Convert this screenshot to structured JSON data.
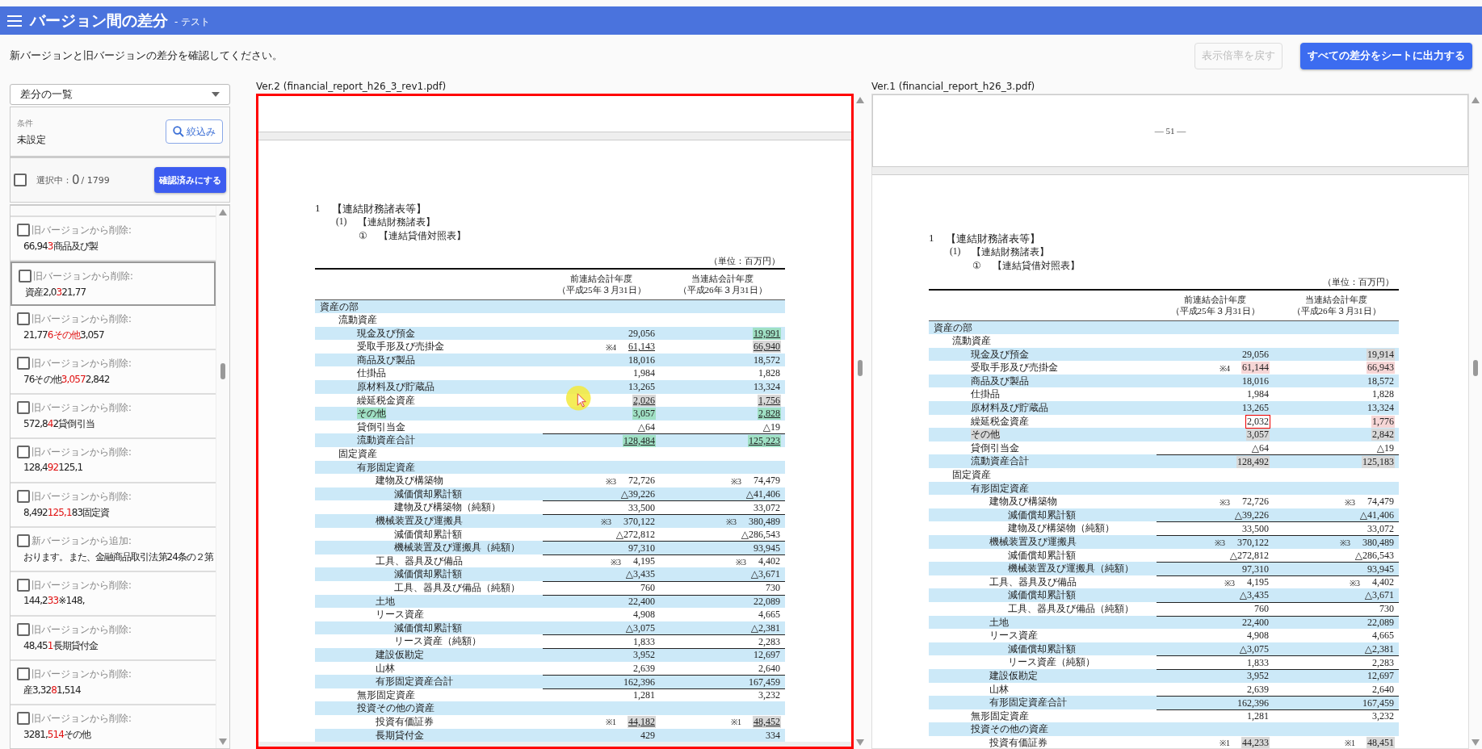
{
  "header": {
    "title": "バージョン間の差分",
    "subtitle": "- テスト"
  },
  "instruction": "新バージョンと旧バージョンの差分を確認してください。",
  "actions": [
    {
      "label": "表示倍率を戻す",
      "disabled": true
    },
    {
      "label": "すべての差分をシートに出力する",
      "disabled": false
    }
  ],
  "sidebar": {
    "dropdown": "差分の一覧",
    "condition_label": "条件",
    "condition_value": "未設定",
    "filter_button": "絞込み",
    "select_all_checked": false,
    "selected_label": "選択中：",
    "selected_count": "0",
    "total": "/ 1799",
    "confirm_button": "確認済みにする",
    "items": [
      {
        "label": "旧バージョンから削除:",
        "before": "66,94",
        "changed": "3",
        "after": "商品及び製",
        "checked": false,
        "selected": false
      },
      {
        "label": "旧バージョンから削除:",
        "before": "資産2,0",
        "changed": "3",
        "after": "21,77",
        "checked": false,
        "selected": true
      },
      {
        "label": "旧バージョンから削除:",
        "before": "21,77",
        "changed": "6その他",
        "after": "3,057",
        "checked": false,
        "selected": false
      },
      {
        "label": "旧バージョンから削除:",
        "before": "76その他",
        "changed": "3,057",
        "after": "2,842",
        "checked": false,
        "selected": false
      },
      {
        "label": "旧バージョンから削除:",
        "before": "572,8",
        "changed": "4",
        "after": "2貸倒引当",
        "checked": false,
        "selected": false
      },
      {
        "label": "旧バージョンから削除:",
        "before": "128,4",
        "changed": "92",
        "after": "125,1",
        "checked": false,
        "selected": false
      },
      {
        "label": "旧バージョンから削除:",
        "before": "8,492",
        "changed": "125,1",
        "after": "83固定資",
        "checked": false,
        "selected": false
      },
      {
        "label": "新バージョンから追加:",
        "before": "おります。また、金融商品取引法第24条の２第",
        "checked": false,
        "selected": false
      },
      {
        "label": "旧バージョンから削除:",
        "before": "144,2",
        "changed": "33",
        "after": "※148,",
        "checked": false,
        "selected": false
      },
      {
        "label": "旧バージョンから削除:",
        "before": "48,45",
        "changed": "1",
        "after": "長期貸付金",
        "checked": false,
        "selected": false
      },
      {
        "label": "旧バージョンから削除:",
        "before": "産3,32",
        "changed": "8",
        "after": "1,514",
        "checked": false,
        "selected": false
      },
      {
        "label": "旧バージョンから削除:",
        "before": "3281,",
        "changed": "514",
        "after": "その他",
        "checked": false,
        "selected": false
      }
    ]
  },
  "panes": [
    {
      "title": "Ver.2 (financial_report_h26_3_rev1.pdf)",
      "selected": true,
      "section": {
        "number": "1",
        "text": "【連結財務諸表等】"
      },
      "subsection": {
        "number": "(1)",
        "text": "【連結財務諸表】"
      },
      "table_title": {
        "number": "①",
        "text": "【連結貸借対照表】"
      },
      "unit": "（単位：百万円）",
      "columns": [
        {
          "line1": "前連結会計年度",
          "line2": "（平成25年３月31日）"
        },
        {
          "line1": "当連結会計年度",
          "line2": "（平成26年３月31日）"
        }
      ],
      "rows": [
        {
          "label": "資産の部",
          "children": [
            {
              "label": "流動資産",
              "children": [
                {
                  "label": "現金及び預金",
                  "prev": {
                    "value": "29,056"
                  },
                  "cur": {
                    "value": "19,991",
                    "color": "#9fe0c4",
                    "underline": true
                  }
                },
                {
                  "label": "受取手形及び売掛金",
                  "prev": {
                    "note": "※4",
                    "value": "61,143",
                    "underline": true
                  },
                  "cur": {
                    "value": "66,940",
                    "color": "#d8d8d8",
                    "underline": true
                  }
                },
                {
                  "label": "商品及び製品",
                  "prev": {
                    "value": "18,016"
                  },
                  "cur": {
                    "value": "18,572"
                  }
                },
                {
                  "label": "仕掛品",
                  "prev": {
                    "value": "1,984"
                  },
                  "cur": {
                    "value": "1,828"
                  }
                },
                {
                  "label": "原材料及び貯蔵品",
                  "prev": {
                    "value": "13,265"
                  },
                  "cur": {
                    "value": "13,324"
                  }
                },
                {
                  "label": "繰延税金資産",
                  "prev": {
                    "value": "2,026",
                    "color": "#d8d8d8",
                    "underline": true
                  },
                  "cur": {
                    "value": "1,756",
                    "color": "#d8d8d8",
                    "underline": true
                  }
                },
                {
                  "label": "その他",
                  "color": "#9fe0c4",
                  "prev": {
                    "value": "3,057",
                    "color": "#9fe0c4"
                  },
                  "cur": {
                    "value": "2,828",
                    "color": "#9fe0c4",
                    "underline": true
                  }
                },
                {
                  "label": "貸倒引当金",
                  "prev": {
                    "value": "△64"
                  },
                  "cur": {
                    "value": "△19"
                  }
                },
                {
                  "label": "流動資産合計",
                  "rule": true,
                  "prev": {
                    "value": "128,484",
                    "color": "#9fe0c4",
                    "underline": true
                  },
                  "cur": {
                    "value": "125,223",
                    "color": "#9fe0c4",
                    "underline": true
                  }
                }
              ]
            },
            {
              "label": "固定資産",
              "children": [
                {
                  "label": "有形固定資産",
                  "children": [
                    {
                      "label": "建物及び構築物",
                      "prev": {
                        "note": "※3",
                        "value": "72,726"
                      },
                      "cur": {
                        "note": "※3",
                        "value": "74,479"
                      },
                      "children": [
                        {
                          "label": "減価償却累計額",
                          "prev": {
                            "value": "△39,226"
                          },
                          "cur": {
                            "value": "△41,406"
                          }
                        },
                        {
                          "label": "建物及び構築物（純額）",
                          "rule": true,
                          "prev": {
                            "value": "33,500"
                          },
                          "cur": {
                            "value": "33,072"
                          }
                        }
                      ]
                    },
                    {
                      "label": "機械装置及び運搬具",
                      "rule": true,
                      "prev": {
                        "note": "※3",
                        "value": "370,122"
                      },
                      "cur": {
                        "note": "※3",
                        "value": "380,489"
                      },
                      "children": [
                        {
                          "label": "減価償却累計額",
                          "prev": {
                            "value": "△272,812"
                          },
                          "cur": {
                            "value": "△286,543"
                          }
                        },
                        {
                          "label": "機械装置及び運搬具（純額）",
                          "rule": true,
                          "prev": {
                            "value": "97,310"
                          },
                          "cur": {
                            "value": "93,945"
                          }
                        }
                      ]
                    },
                    {
                      "label": "工具、器具及び備品",
                      "rule": true,
                      "prev": {
                        "note": "※3",
                        "value": "4,195"
                      },
                      "cur": {
                        "note": "※3",
                        "value": "4,402"
                      },
                      "children": [
                        {
                          "label": "減価償却累計額",
                          "prev": {
                            "value": "△3,435"
                          },
                          "cur": {
                            "value": "△3,671"
                          }
                        },
                        {
                          "label": "工具、器具及び備品（純額）",
                          "rule": true,
                          "prev": {
                            "value": "760"
                          },
                          "cur": {
                            "value": "730"
                          }
                        }
                      ]
                    },
                    {
                      "label": "土地",
                      "rule": true,
                      "prev": {
                        "value": "22,400"
                      },
                      "cur": {
                        "value": "22,089"
                      }
                    },
                    {
                      "label": "リース資産",
                      "prev": {
                        "value": "4,908"
                      },
                      "cur": {
                        "value": "4,665"
                      },
                      "children": [
                        {
                          "label": "減価償却累計額",
                          "prev": {
                            "value": "△3,075"
                          },
                          "cur": {
                            "value": "△2,381"
                          }
                        },
                        {
                          "label": "リース資産（純額）",
                          "rule": true,
                          "prev": {
                            "value": "1,833"
                          },
                          "cur": {
                            "value": "2,283"
                          }
                        }
                      ]
                    },
                    {
                      "label": "建設仮勘定",
                      "rule": true,
                      "prev": {
                        "value": "3,952"
                      },
                      "cur": {
                        "value": "12,697"
                      }
                    },
                    {
                      "label": "山林",
                      "prev": {
                        "value": "2,639"
                      },
                      "cur": {
                        "value": "2,640"
                      }
                    },
                    {
                      "label": "有形固定資産合計",
                      "rule": true,
                      "prev": {
                        "value": "162,396"
                      },
                      "cur": {
                        "value": "167,459"
                      }
                    }
                  ]
                },
                {
                  "label": "無形固定資産",
                  "rule": true,
                  "prev": {
                    "value": "1,281"
                  },
                  "cur": {
                    "value": "3,232"
                  }
                },
                {
                  "label": "投資その他の資産",
                  "children": [
                    {
                      "label": "投資有価証券",
                      "prev": {
                        "note": "※1",
                        "value": "44,182",
                        "color": "#d8d8d8",
                        "underline": true
                      },
                      "cur": {
                        "note": "※1",
                        "value": "48,452",
                        "color": "#d8d8d8",
                        "underline": true
                      }
                    },
                    {
                      "label": "長期貸付金",
                      "prev": {
                        "value": "429"
                      },
                      "cur": {
                        "value": "334"
                      }
                    }
                  ]
                }
              ]
            }
          ]
        }
      ]
    },
    {
      "title": "Ver.1 (financial_report_h26_3.pdf)",
      "selected": false,
      "prev_page_number": "— 51 —",
      "section": {
        "number": "1",
        "text": "【連結財務諸表等】"
      },
      "subsection": {
        "number": "(1)",
        "text": "【連結財務諸表】"
      },
      "table_title": {
        "number": "①",
        "text": "【連結貸借対照表】"
      },
      "unit": "（単位：百万円）",
      "columns": [
        {
          "line1": "前連結会計年度",
          "line2": "（平成25年３月31日）"
        },
        {
          "line1": "当連結会計年度",
          "line2": "（平成26年３月31日）"
        }
      ],
      "rows": [
        {
          "label": "資産の部",
          "children": [
            {
              "label": "流動資産",
              "children": [
                {
                  "label": "現金及び預金",
                  "prev": {
                    "value": "29,056"
                  },
                  "cur": {
                    "value": "19,914",
                    "color": "#d8d8d8"
                  }
                },
                {
                  "label": "受取手形及び売掛金",
                  "prev": {
                    "note": "※4",
                    "value": "61,144",
                    "color": "#f6d6d6"
                  },
                  "cur": {
                    "value": "66,943",
                    "color": "#f6d6d6"
                  }
                },
                {
                  "label": "商品及び製品",
                  "prev": {
                    "value": "18,016"
                  },
                  "cur": {
                    "value": "18,572"
                  }
                },
                {
                  "label": "仕掛品",
                  "prev": {
                    "value": "1,984"
                  },
                  "cur": {
                    "value": "1,828"
                  }
                },
                {
                  "label": "原材料及び貯蔵品",
                  "prev": {
                    "value": "13,265"
                  },
                  "cur": {
                    "value": "13,324"
                  }
                },
                {
                  "label": "繰延税金資産",
                  "prev": {
                    "value": "2,032",
                    "boxed": true
                  },
                  "cur": {
                    "value": "1,776",
                    "color": "#f6d6d6"
                  }
                },
                {
                  "label": "その他",
                  "color": "#d8d8d8",
                  "prev": {
                    "value": "3,057",
                    "color": "#d8d8d8"
                  },
                  "cur": {
                    "value": "2,842",
                    "color": "#d8d8d8"
                  }
                },
                {
                  "label": "貸倒引当金",
                  "prev": {
                    "value": "△64"
                  },
                  "cur": {
                    "value": "△19"
                  }
                },
                {
                  "label": "流動資産合計",
                  "rule": true,
                  "prev": {
                    "value": "128,492",
                    "color": "#d8d8d8"
                  },
                  "cur": {
                    "value": "125,183",
                    "color": "#d8d8d8"
                  }
                }
              ]
            },
            {
              "label": "固定資産",
              "children": [
                {
                  "label": "有形固定資産",
                  "children": [
                    {
                      "label": "建物及び構築物",
                      "prev": {
                        "note": "※3",
                        "value": "72,726"
                      },
                      "cur": {
                        "note": "※3",
                        "value": "74,479"
                      },
                      "children": [
                        {
                          "label": "減価償却累計額",
                          "prev": {
                            "value": "△39,226"
                          },
                          "cur": {
                            "value": "△41,406"
                          }
                        },
                        {
                          "label": "建物及び構築物（純額）",
                          "rule": true,
                          "prev": {
                            "value": "33,500"
                          },
                          "cur": {
                            "value": "33,072"
                          }
                        }
                      ]
                    },
                    {
                      "label": "機械装置及び運搬具",
                      "rule": true,
                      "prev": {
                        "note": "※3",
                        "value": "370,122"
                      },
                      "cur": {
                        "note": "※3",
                        "value": "380,489"
                      },
                      "children": [
                        {
                          "label": "減価償却累計額",
                          "prev": {
                            "value": "△272,812"
                          },
                          "cur": {
                            "value": "△286,543"
                          }
                        },
                        {
                          "label": "機械装置及び運搬具（純額）",
                          "rule": true,
                          "prev": {
                            "value": "97,310"
                          },
                          "cur": {
                            "value": "93,945"
                          }
                        }
                      ]
                    },
                    {
                      "label": "工具、器具及び備品",
                      "rule": true,
                      "prev": {
                        "note": "※3",
                        "value": "4,195"
                      },
                      "cur": {
                        "note": "※3",
                        "value": "4,402"
                      },
                      "children": [
                        {
                          "label": "減価償却累計額",
                          "prev": {
                            "value": "△3,435"
                          },
                          "cur": {
                            "value": "△3,671"
                          }
                        },
                        {
                          "label": "工具、器具及び備品（純額）",
                          "rule": true,
                          "prev": {
                            "value": "760"
                          },
                          "cur": {
                            "value": "730"
                          }
                        }
                      ]
                    },
                    {
                      "label": "土地",
                      "rule": true,
                      "prev": {
                        "value": "22,400"
                      },
                      "cur": {
                        "value": "22,089"
                      }
                    },
                    {
                      "label": "リース資産",
                      "prev": {
                        "value": "4,908"
                      },
                      "cur": {
                        "value": "4,665"
                      },
                      "children": [
                        {
                          "label": "減価償却累計額",
                          "prev": {
                            "value": "△3,075"
                          },
                          "cur": {
                            "value": "△2,381"
                          }
                        },
                        {
                          "label": "リース資産（純額）",
                          "rule": true,
                          "prev": {
                            "value": "1,833"
                          },
                          "cur": {
                            "value": "2,283"
                          }
                        }
                      ]
                    },
                    {
                      "label": "建設仮勘定",
                      "rule": true,
                      "prev": {
                        "value": "3,952"
                      },
                      "cur": {
                        "value": "12,697"
                      }
                    },
                    {
                      "label": "山林",
                      "prev": {
                        "value": "2,639"
                      },
                      "cur": {
                        "value": "2,640"
                      }
                    },
                    {
                      "label": "有形固定資産合計",
                      "rule": true,
                      "prev": {
                        "value": "162,396"
                      },
                      "cur": {
                        "value": "167,459"
                      }
                    }
                  ]
                },
                {
                  "label": "無形固定資産",
                  "rule": true,
                  "prev": {
                    "value": "1,281"
                  },
                  "cur": {
                    "value": "3,232"
                  }
                },
                {
                  "label": "投資その他の資産",
                  "children": [
                    {
                      "label": "投資有価証券",
                      "prev": {
                        "note": "※1",
                        "value": "44,233",
                        "color": "#d8d8d8"
                      },
                      "cur": {
                        "note": "※1",
                        "value": "48,451",
                        "color": "#d8d8d8"
                      }
                    }
                  ]
                }
              ]
            }
          ]
        }
      ]
    }
  ]
}
